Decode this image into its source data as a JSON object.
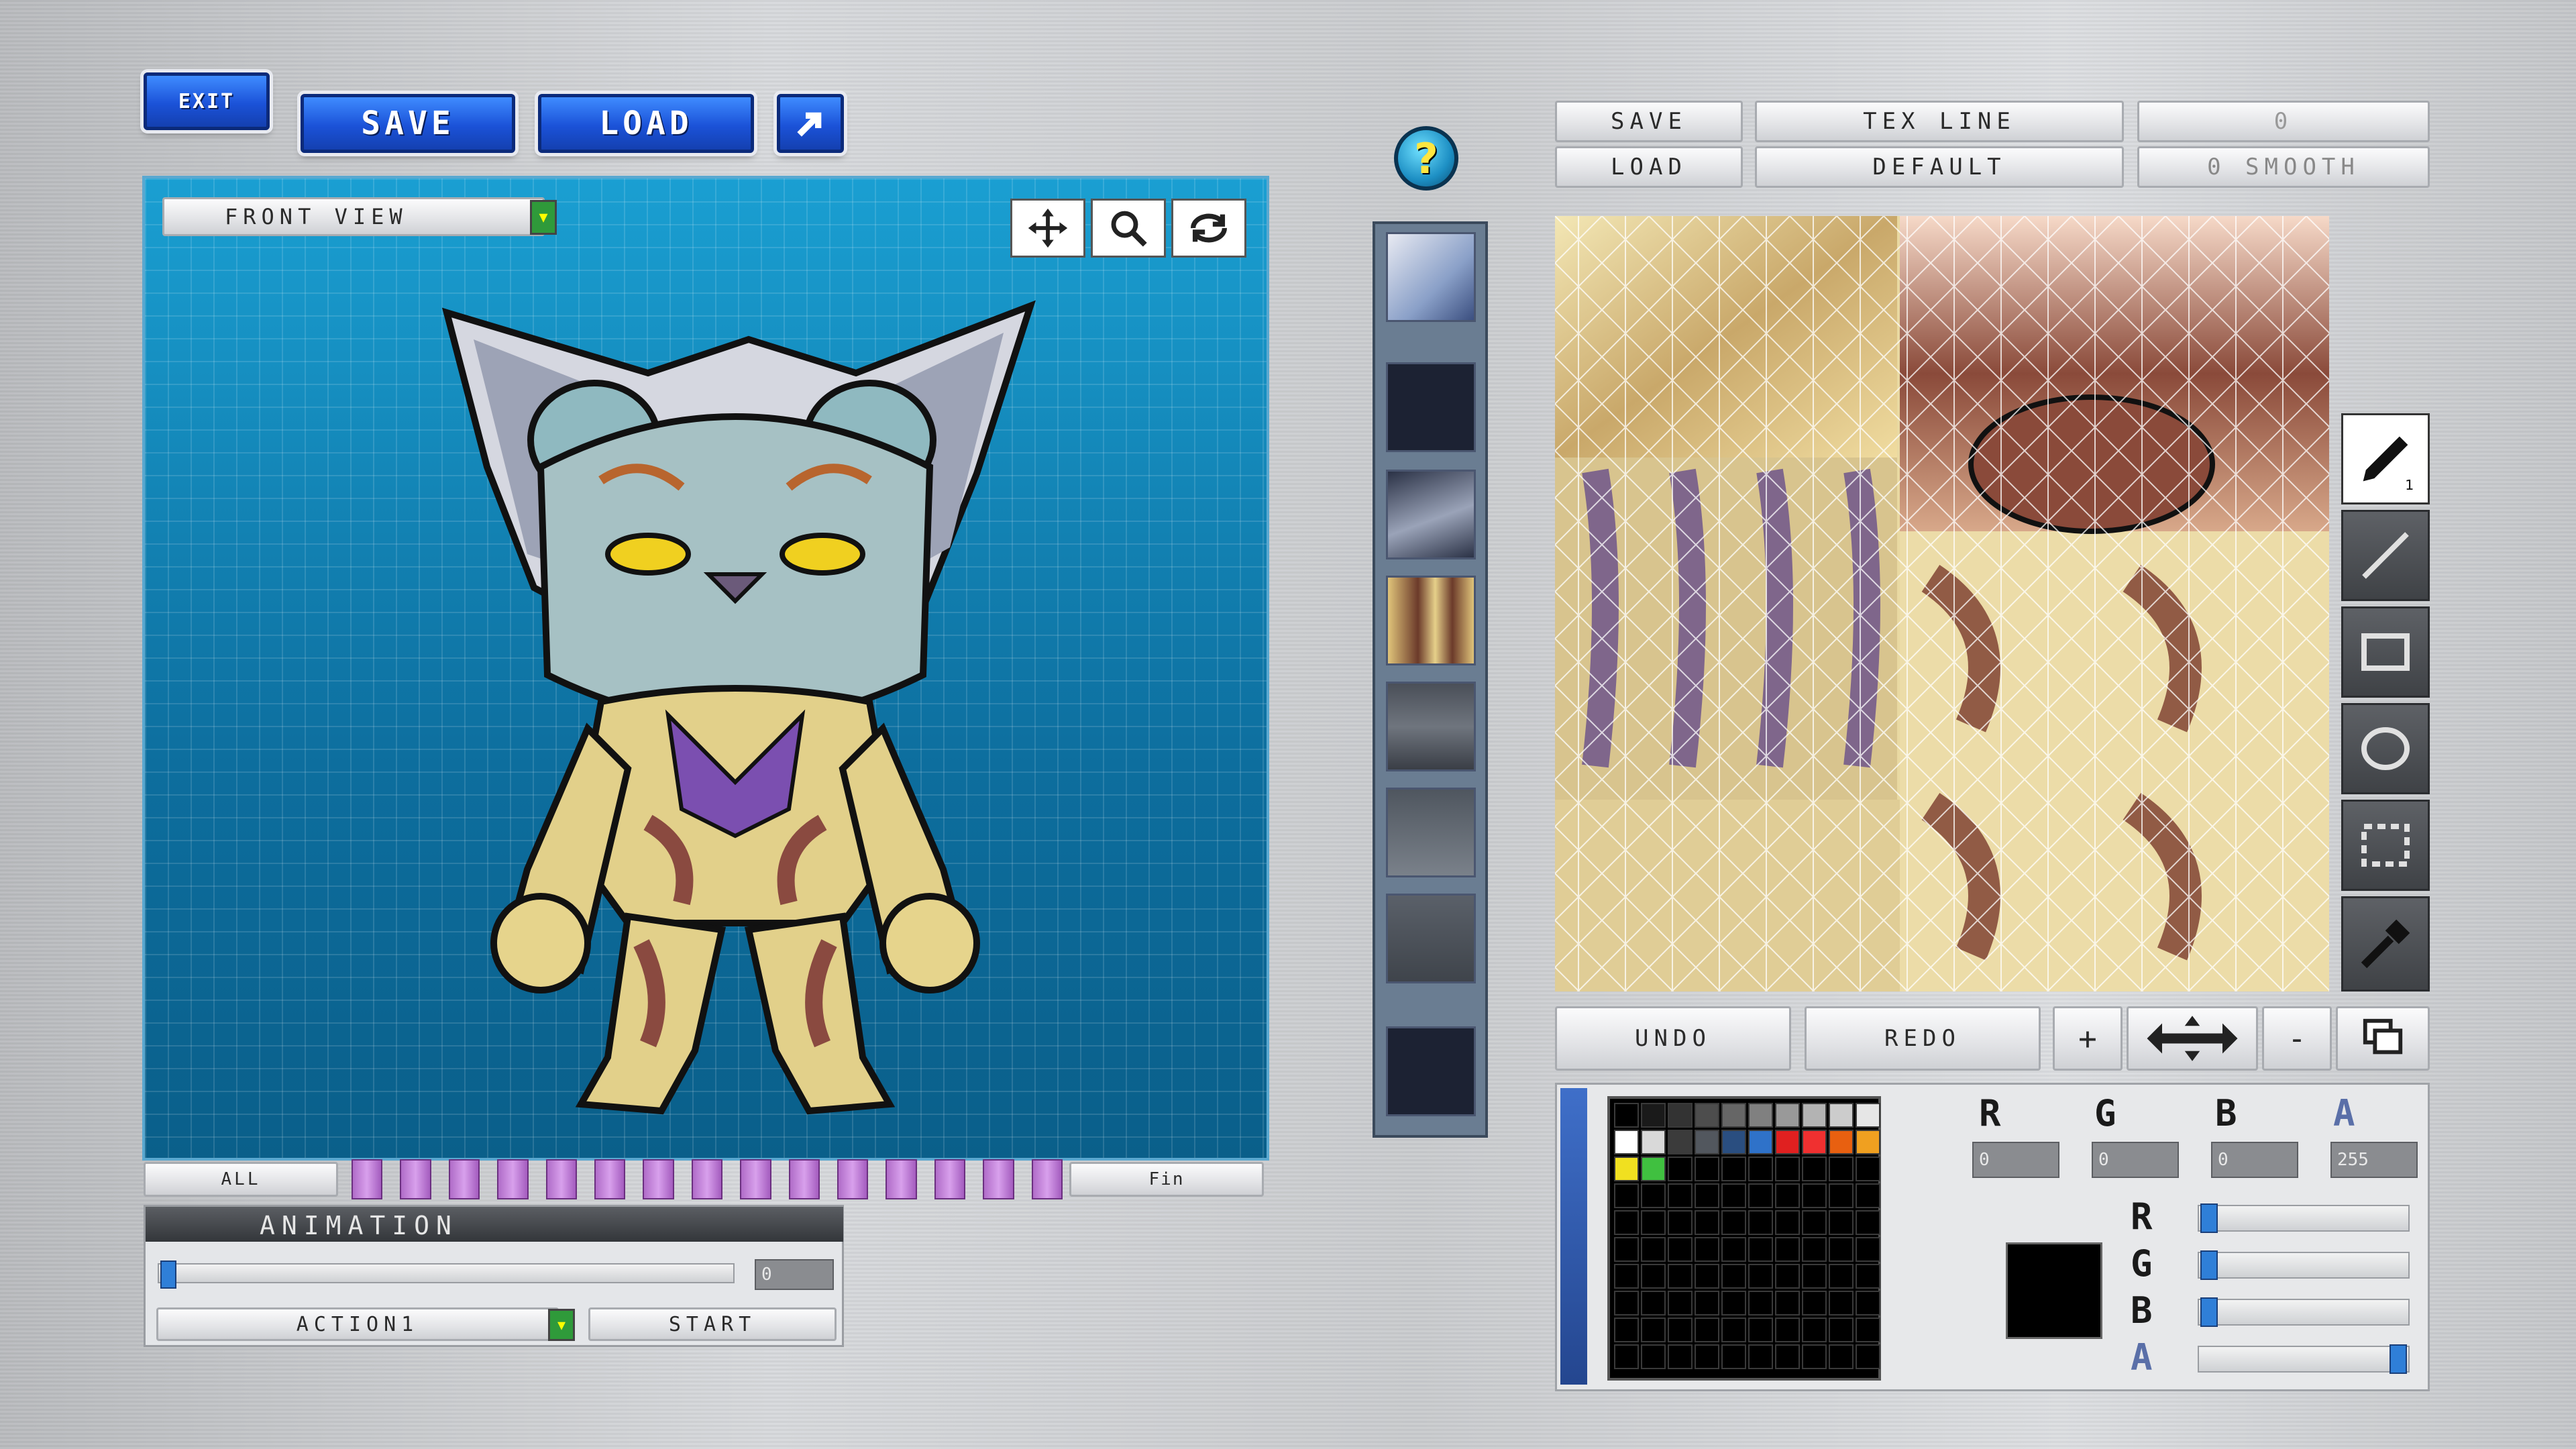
{
  "top_left": {
    "exit": "EXIT",
    "save": "SAVE",
    "load": "LOAD",
    "arrow_icon": "export-arrow-icon"
  },
  "viewport": {
    "view_select": "FRONT VIEW",
    "tools": [
      "move-icon",
      "zoom-icon",
      "rotate-icon"
    ],
    "frames_left": "ALL",
    "frames_right": "Fin",
    "frame_count": 15
  },
  "animation": {
    "title": "ANIMATION",
    "value": "0",
    "action": "ACTION1",
    "start": "START",
    "progress": 0.0
  },
  "help_icon": "question-icon",
  "texture": {
    "save": "SAVE",
    "load": "LOAD",
    "tex_line": "TEX LINE",
    "default": "DEFAULT",
    "option_top": "0",
    "smooth": "0 SMOOTH",
    "undo": "UNDO",
    "redo": "REDO",
    "plus": "+",
    "minus": "-"
  },
  "side_tools": [
    "pen-icon",
    "line-icon",
    "rectangle-icon",
    "ellipse-icon",
    "selection-icon",
    "eyedropper-icon"
  ],
  "palette_colors": [
    "#000000",
    "#1a1a1a",
    "#333333",
    "#4d4d4d",
    "#666666",
    "#808080",
    "#999999",
    "#b3b3b3",
    "#cccccc",
    "#e6e6e6",
    "#ffffff",
    "#d9d9d9",
    "#3b3b3b",
    "#52575e",
    "#2a4e80",
    "#2f72c9",
    "#e02020",
    "#f03030",
    "#e86010",
    "#f0a020",
    "#f0e020",
    "#40c040"
  ],
  "channels": {
    "r": "R",
    "g": "G",
    "b": "B",
    "a": "A",
    "r_val": "0",
    "g_val": "0",
    "b_val": "0",
    "a_val": "255",
    "r_level": 0.0,
    "g_level": 0.0,
    "b_level": 0.0,
    "a_level": 1.0
  },
  "current_color": "#000000"
}
